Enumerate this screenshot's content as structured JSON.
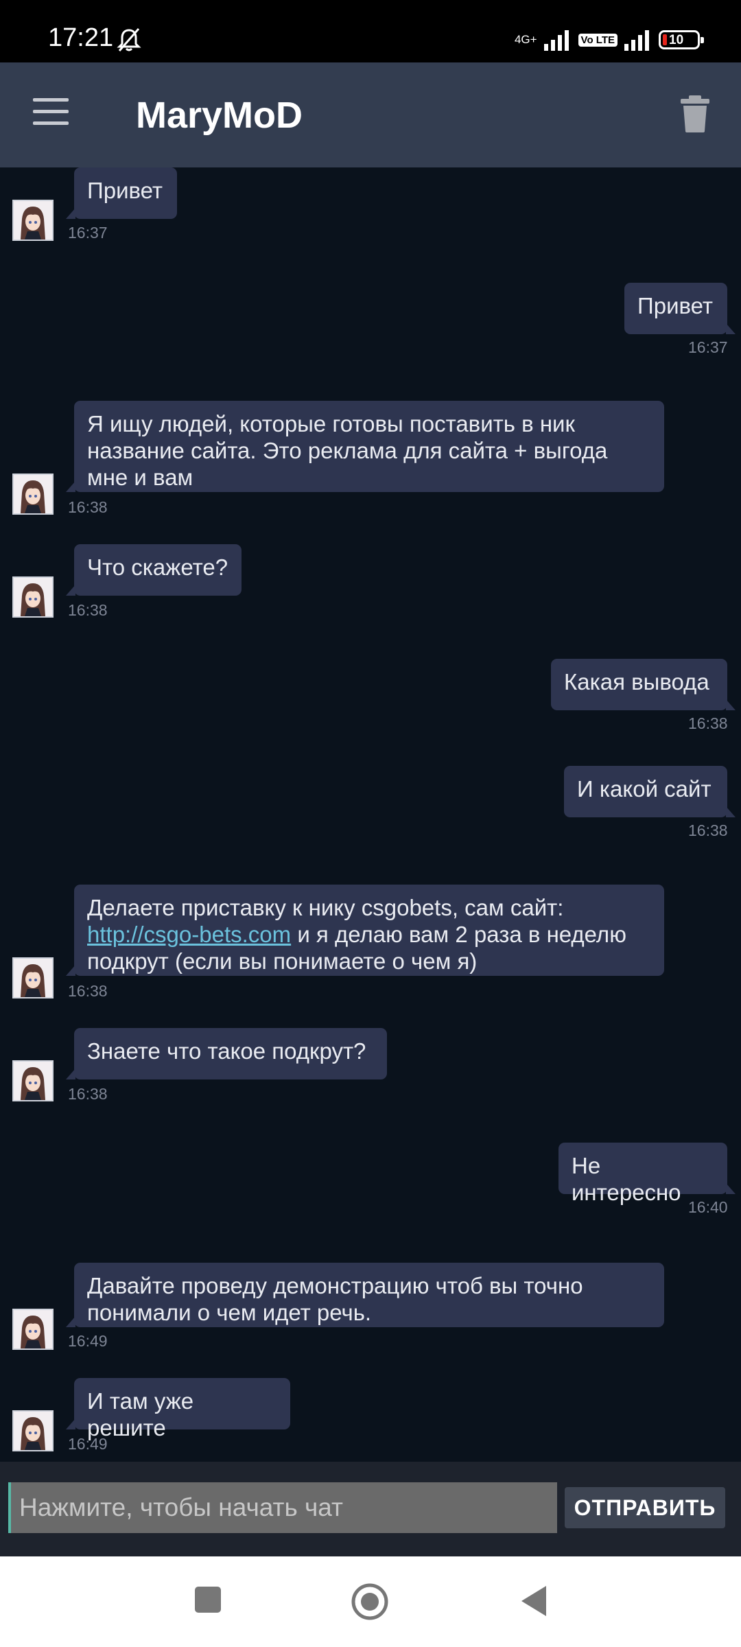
{
  "status_bar": {
    "time": "17:21",
    "network": "4G+",
    "volte": "Vo LTE",
    "battery": "10"
  },
  "app_bar": {
    "title": "MaryMoD",
    "menu_icon": "hamburger-menu-icon",
    "delete_icon": "trash-icon"
  },
  "messages": [
    {
      "dir": "in",
      "text": "Привет",
      "time": "16:37"
    },
    {
      "dir": "out",
      "text": "Привет",
      "time": "16:37"
    },
    {
      "dir": "in",
      "text": "Я ищу людей, которые готовы поставить в ник название сайта. Это реклама для сайта + выгода мне и вам",
      "time": "16:38"
    },
    {
      "dir": "in",
      "text": "Что скажете?",
      "time": "16:38"
    },
    {
      "dir": "out",
      "text": "Какая вывода",
      "time": "16:38"
    },
    {
      "dir": "out",
      "text": "И какой сайт",
      "time": "16:38"
    },
    {
      "dir": "in",
      "text_before": "Делаете приставку к нику csgobets, сам сайт:",
      "link": "http://csgo-bets.com",
      "text_after": "и я делаю вам 2 раза в неделю подкрут (если вы понимаете о чем я)",
      "time": "16:38"
    },
    {
      "dir": "in",
      "text": "Знаете что такое  подкрут?",
      "time": "16:38"
    },
    {
      "dir": "out",
      "text": "Не интересно",
      "time": "16:40"
    },
    {
      "dir": "in",
      "text": "Давайте проведу демонстрацию чтоб вы точно понимали о чем идет речь.",
      "time": "16:49"
    },
    {
      "dir": "in",
      "text": "И там уже решите",
      "time": "16:49"
    }
  ],
  "input": {
    "placeholder": "Нажмите, чтобы начать чат",
    "value": "",
    "send_label": "ОТПРАВИТЬ"
  },
  "colors": {
    "background": "#0a121c",
    "app_bar": "#333d50",
    "bubble": "#2e3550",
    "link": "#6bc2dd"
  }
}
